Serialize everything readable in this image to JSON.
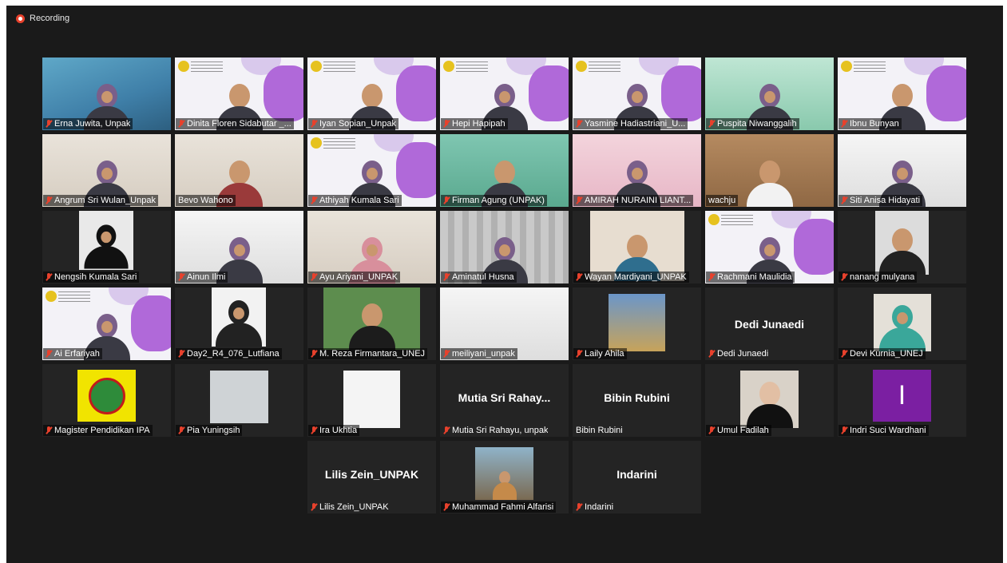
{
  "recording": {
    "label": "Recording"
  },
  "participants": [
    {
      "name": "Erna Juwita, Unpak",
      "muted": true
    },
    {
      "name": "Dinita Floren Sidabutar _...",
      "muted": true
    },
    {
      "name": "Iyan Sopian_Unpak",
      "muted": true
    },
    {
      "name": "Hepi Hapipah",
      "muted": true
    },
    {
      "name": "Yasmine Hadiastriani_U...",
      "muted": true
    },
    {
      "name": "Puspita Niwanggalih",
      "muted": true
    },
    {
      "name": "Ibnu Bunyan",
      "muted": true
    },
    {
      "name": "Angrum Sri Wulan_Unpak",
      "muted": true
    },
    {
      "name": "Bevo Wahono",
      "muted": false
    },
    {
      "name": "Athiyah Kumala Sari",
      "muted": true
    },
    {
      "name": "Firman Agung (UNPAK)",
      "muted": true
    },
    {
      "name": "AMIRAH NURAINI LIANT...",
      "muted": true
    },
    {
      "name": "wachju",
      "muted": false
    },
    {
      "name": "Siti Anisa Hidayati",
      "muted": true
    },
    {
      "name": "Nengsih Kumala Sari",
      "muted": true
    },
    {
      "name": "Ainun Ilmi",
      "muted": true
    },
    {
      "name": "Ayu Ariyani_UNPAK",
      "muted": true
    },
    {
      "name": "Aminatul Husna",
      "muted": true
    },
    {
      "name": "Wayan Mardiyani_UNPAK",
      "muted": true
    },
    {
      "name": "Rachmani Maulidia",
      "muted": true
    },
    {
      "name": "nanang mulyana",
      "muted": true
    },
    {
      "name": "Ai Erfariyah",
      "muted": true
    },
    {
      "name": "Day2_R4_076_Lutfiana",
      "muted": true
    },
    {
      "name": "M. Reza Firmantara_UNEJ",
      "muted": true
    },
    {
      "name": "meiliyani_unpak",
      "muted": true
    },
    {
      "name": "Laily Ahila",
      "muted": true
    },
    {
      "name": "Dedi Junaedi",
      "muted": true,
      "display_name": "Dedi Junaedi"
    },
    {
      "name": "Devi Kurnia_UNEJ",
      "muted": true
    },
    {
      "name": "Magister Pendidikan IPA",
      "muted": true
    },
    {
      "name": "Pia Yuningsih",
      "muted": true
    },
    {
      "name": "Ira Ukhtia",
      "muted": true
    },
    {
      "name": "Mutia Sri Rahayu, unpak",
      "muted": true,
      "display_name": "Mutia Sri Rahay..."
    },
    {
      "name": "Bibin Rubini",
      "muted": false,
      "display_name": "Bibin Rubini"
    },
    {
      "name": "Umul Fadilah",
      "muted": true
    },
    {
      "name": "Indri Suci Wardhani",
      "muted": true,
      "initial": "I"
    },
    {
      "name": "Lilis Zein_UNPAK",
      "muted": true,
      "display_name": "Lilis Zein_UNPAK"
    },
    {
      "name": "Muhammad Fahmi Alfarisi",
      "muted": true
    },
    {
      "name": "Indarini",
      "muted": true,
      "display_name": "Indarini"
    }
  ],
  "colors": {
    "background": "#1a1a1a",
    "tile": "#242424",
    "muted": "#e8412c",
    "active_speaker": "#d5d86a"
  }
}
